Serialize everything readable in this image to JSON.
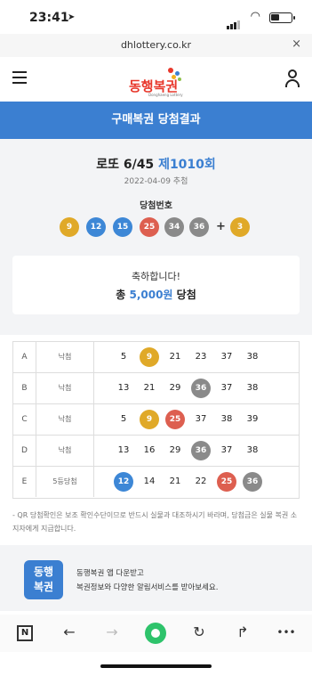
{
  "status_bar": {
    "time": "23:41",
    "location_icon": "location-arrow-icon",
    "signal_icon": "signal-icon",
    "wifi_icon": "wifi-icon",
    "battery_icon": "battery-icon"
  },
  "browser": {
    "url": "dhlottery.co.kr",
    "close_label": "×"
  },
  "header": {
    "menu_icon": "menu-icon",
    "logo_text": "동행복권",
    "logo_sub": "Donghaeng Lottery",
    "user_icon": "user-icon"
  },
  "banner": {
    "title": "구매복권 당첨결과"
  },
  "game": {
    "name": "로또 6/45",
    "round": "제1010회",
    "draw_date": "2022-04-09 추첨",
    "winning_label": "당첨번호",
    "winning_numbers": [
      "9",
      "12",
      "15",
      "25",
      "34",
      "36"
    ],
    "plus": "+",
    "bonus_number": "3"
  },
  "prize": {
    "congrats": "축하합니다!",
    "prefix": "총",
    "amount": "5,000원",
    "suffix": "당첨"
  },
  "results": [
    {
      "letter": "A",
      "status": "낙첨",
      "numbers": [
        "5",
        "9",
        "21",
        "23",
        "37",
        "38"
      ],
      "hits": [
        false,
        true,
        false,
        false,
        false,
        false
      ]
    },
    {
      "letter": "B",
      "status": "낙첨",
      "numbers": [
        "13",
        "21",
        "29",
        "36",
        "37",
        "38"
      ],
      "hits": [
        false,
        false,
        false,
        true,
        false,
        false
      ]
    },
    {
      "letter": "C",
      "status": "낙첨",
      "numbers": [
        "5",
        "9",
        "25",
        "37",
        "38",
        "39"
      ],
      "hits": [
        false,
        true,
        true,
        false,
        false,
        false
      ]
    },
    {
      "letter": "D",
      "status": "낙첨",
      "numbers": [
        "13",
        "16",
        "29",
        "36",
        "37",
        "38"
      ],
      "hits": [
        false,
        false,
        false,
        true,
        false,
        false
      ]
    },
    {
      "letter": "E",
      "status": "5등당첨",
      "numbers": [
        "12",
        "14",
        "21",
        "22",
        "25",
        "36"
      ],
      "hits": [
        true,
        false,
        false,
        false,
        true,
        true
      ]
    }
  ],
  "notice": "- QR 당첨확인은 보조 확인수단이므로 반드시 실물과 대조하시기 바라며, 당첨금은 실물 복권 소지자에게 지급합니다.",
  "promo": {
    "icon_text": "동행\n복권",
    "line1": "동행복권 앱 다운받고",
    "line2": "복권정보와 다양한 알림서비스를 받아보세요."
  },
  "toolbar": {
    "n_label": "N",
    "back_icon": "back-arrow-icon",
    "forward_icon": "forward-arrow-icon",
    "home_icon": "home-icon",
    "refresh_icon": "refresh-icon",
    "share_icon": "share-icon",
    "more_icon": "more-icon"
  },
  "colors": {
    "banner": "#3b7fd1",
    "ball_yellow": "#e0a928",
    "ball_blue": "#3d87d6",
    "ball_red": "#dd5f50",
    "ball_gray": "#8a8a8a",
    "ball_green": "#8fc04a"
  }
}
